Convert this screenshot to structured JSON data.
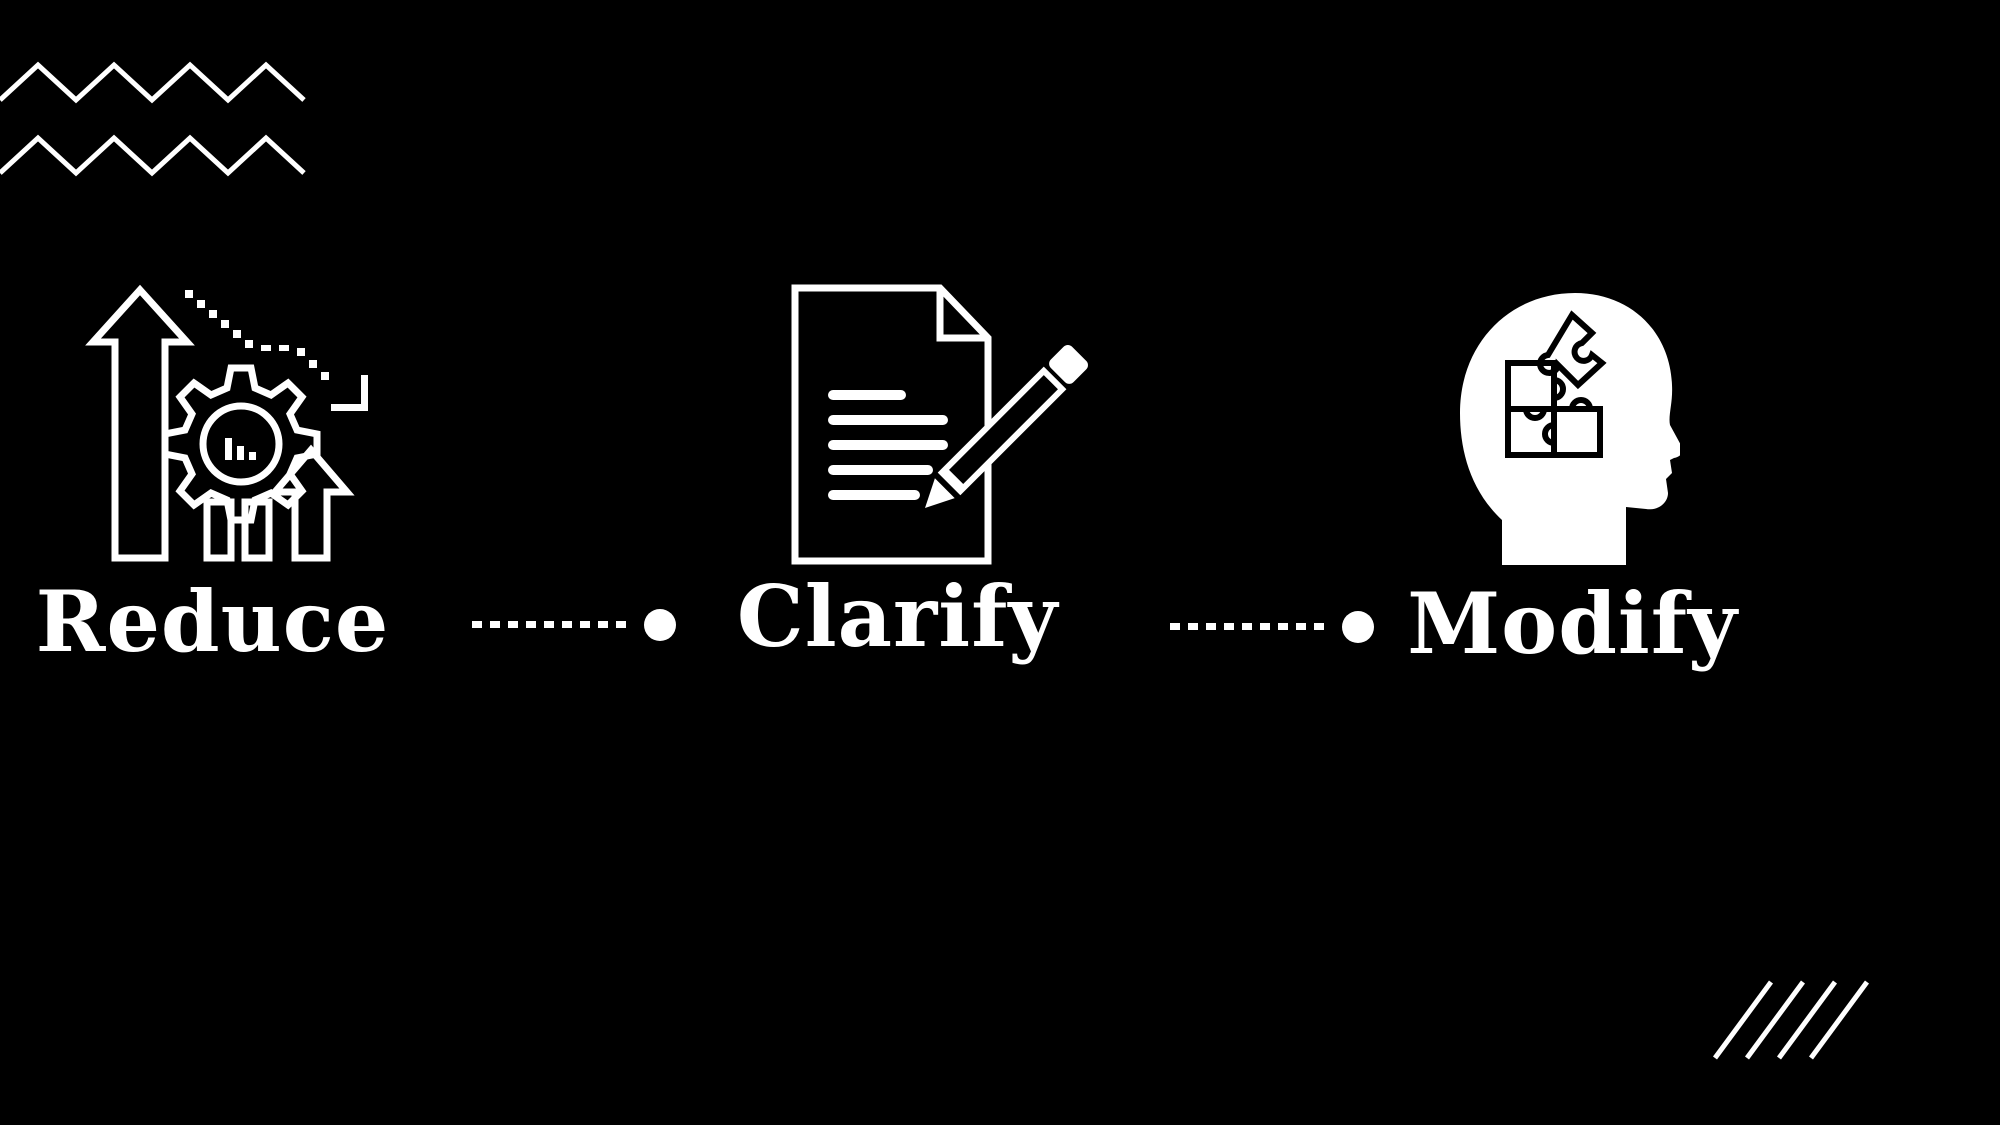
{
  "colors": {
    "background": "#000000",
    "foreground": "#ffffff"
  },
  "steps": [
    {
      "label": "Reduce",
      "icon": "growth-gear-icon"
    },
    {
      "label": "Clarify",
      "icon": "document-pencil-icon"
    },
    {
      "label": "Modify",
      "icon": "head-puzzle-icon"
    }
  ],
  "connectors": [
    {
      "from": "Reduce",
      "to": "Clarify",
      "style": "dotted-arrow-dot"
    },
    {
      "from": "Clarify",
      "to": "Modify",
      "style": "dotted-arrow-dot"
    }
  ],
  "decorations": [
    "zigzag-lines",
    "diagonal-stripes"
  ]
}
